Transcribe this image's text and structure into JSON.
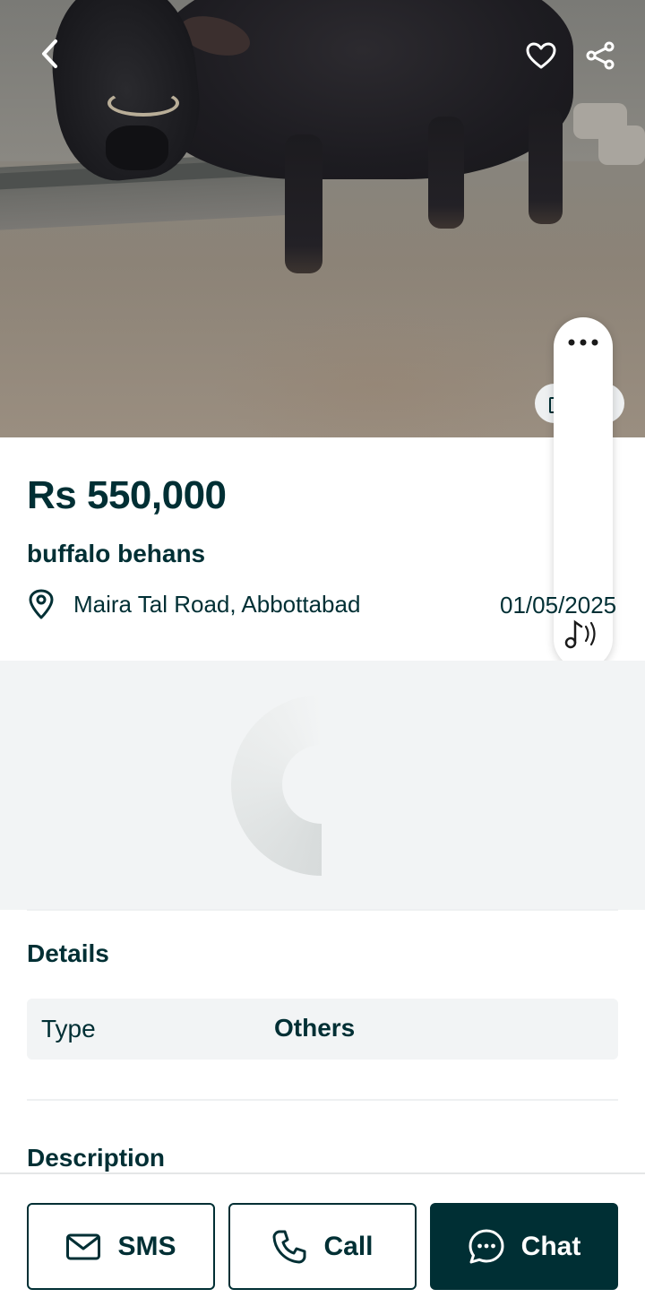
{
  "listing": {
    "price": "Rs 550,000",
    "title": "buffalo behans",
    "location": "Maira Tal Road, Abbottabad",
    "date": "01/05/2025"
  },
  "details": {
    "heading": "Details",
    "rows": [
      {
        "label": "Type",
        "value": "Others"
      }
    ]
  },
  "description": {
    "heading": "Description"
  },
  "actions": {
    "sms_label": "SMS",
    "call_label": "Call",
    "chat_label": "Chat"
  },
  "icons": {
    "back": "chevron-left-icon",
    "favorite": "heart-icon",
    "share": "share-icon",
    "more": "more-dots-icon",
    "audio": "music-note-icon",
    "location": "map-pin-icon",
    "sms": "mail-icon",
    "call": "phone-icon",
    "chat": "chat-bubble-icon"
  },
  "colors": {
    "primary": "#002f34",
    "surface": "#f2f4f5",
    "background": "#ffffff"
  }
}
